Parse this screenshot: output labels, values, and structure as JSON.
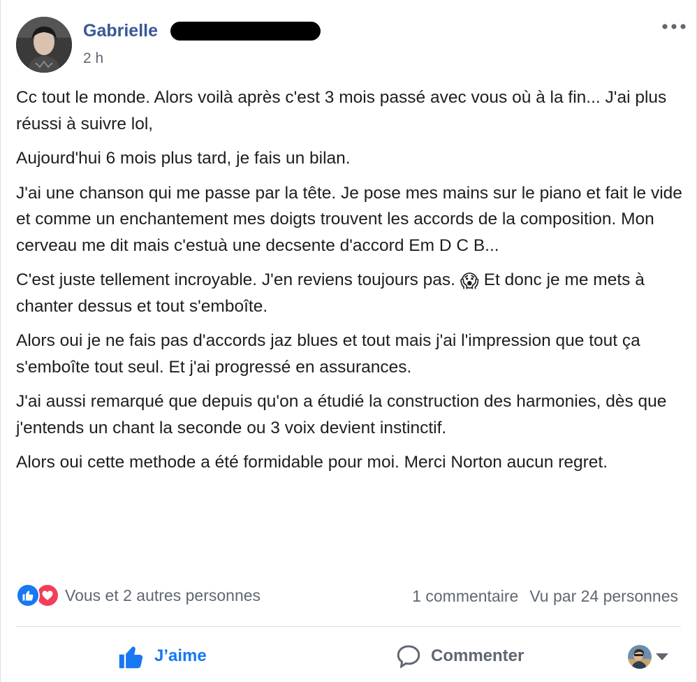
{
  "post": {
    "author": {
      "name": "Gabrielle"
    },
    "timestamp": "2 h",
    "paragraphs": [
      {
        "text": "Cc tout le monde. Alors voilà après c'est 3 mois passé avec vous où à la fin... J'ai plus réussi à suivre lol,"
      },
      {
        "text": "Aujourd'hui 6 mois plus tard, je fais un bilan."
      },
      {
        "text": "J'ai une chanson qui me passe par la tête. Je pose mes mains sur le piano et fait le vide et comme un enchantement mes doigts trouvent les accords de la composition. Mon cerveau me dit mais c'estuà une decsente d'accord Em D C B..."
      },
      {
        "before": "C'est juste tellement incroyable. J'en reviens toujours pas. ",
        "emoji": "😱",
        "after": " Et donc je me mets à chanter dessus et tout s'emboîte."
      },
      {
        "text": "Alors oui je ne fais pas d'accords jaz blues et tout mais j'ai l'impression que tout ça s'emboîte tout seul. Et j'ai progressé en assurances."
      },
      {
        "text": "J'ai aussi remarqué que depuis qu'on a étudié la construction des harmonies, dès que j'entends un chant la seconde ou 3 voix devient instinctif."
      },
      {
        "text": "Alors oui cette methode a été formidable pour moi. Merci Norton aucun regret."
      }
    ]
  },
  "reactions": {
    "types": [
      "like-icon",
      "love-icon"
    ],
    "summary": "Vous et 2 autres personnes"
  },
  "stats": {
    "comments": "1 commentaire",
    "views": "Vu par 24 personnes"
  },
  "actions": {
    "like_label": "J’aime",
    "comment_label": "Commenter"
  },
  "colors": {
    "link_blue": "#385898",
    "like_blue": "#1877f2",
    "love_red": "#f33e58",
    "secondary_text": "#606770",
    "primary_text": "#1c1e21"
  }
}
